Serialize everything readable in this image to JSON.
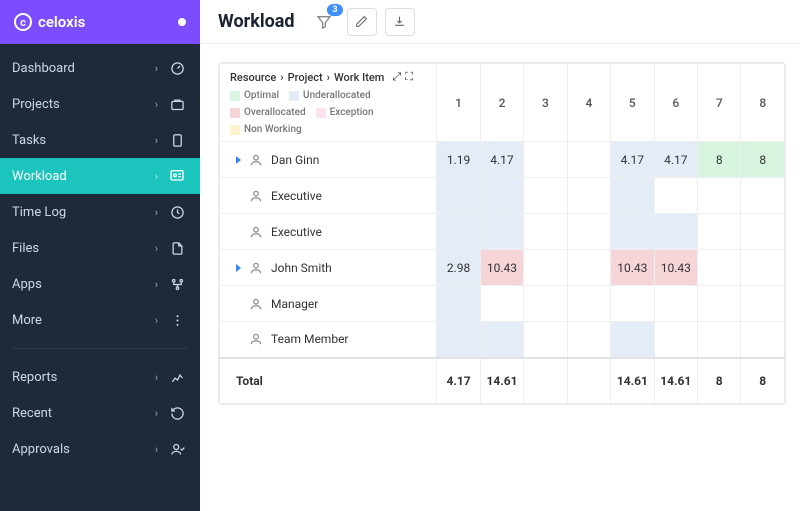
{
  "brand": "celoxis",
  "page_title": "Workload",
  "filter_badge": "3",
  "sidebar": {
    "items": [
      {
        "label": "Dashboard"
      },
      {
        "label": "Projects"
      },
      {
        "label": "Tasks"
      },
      {
        "label": "Workload"
      },
      {
        "label": "Time Log"
      },
      {
        "label": "Files"
      },
      {
        "label": "Apps"
      },
      {
        "label": "More"
      }
    ],
    "items2": [
      {
        "label": "Reports"
      },
      {
        "label": "Recent"
      },
      {
        "label": "Approvals"
      }
    ]
  },
  "breadcrumb": [
    "Resource",
    "Project",
    "Work Item"
  ],
  "legend": [
    {
      "label": "Optimal",
      "color": "#d7f5df"
    },
    {
      "label": "Underallocated",
      "color": "#e3ecf7"
    },
    {
      "label": "Overallocated",
      "color": "#f6d5d8"
    },
    {
      "label": "Exception",
      "color": "#fde2f0"
    },
    {
      "label": "Non Working",
      "color": "#fff3cd"
    }
  ],
  "columns": [
    "1",
    "2",
    "3",
    "4",
    "5",
    "6",
    "7",
    "8"
  ],
  "rows": [
    {
      "name": "Dan Ginn",
      "expandable": true,
      "cells": [
        {
          "v": "1.19",
          "c": "blue"
        },
        {
          "v": "4.17",
          "c": "blue"
        },
        {
          "v": "",
          "c": ""
        },
        {
          "v": "",
          "c": ""
        },
        {
          "v": "4.17",
          "c": "blue"
        },
        {
          "v": "4.17",
          "c": "blue"
        },
        {
          "v": "8",
          "c": "green"
        },
        {
          "v": "8",
          "c": "green"
        }
      ]
    },
    {
      "name": "Executive",
      "expandable": false,
      "cells": [
        {
          "v": "",
          "c": "blue"
        },
        {
          "v": "",
          "c": "blue"
        },
        {
          "v": "",
          "c": ""
        },
        {
          "v": "",
          "c": ""
        },
        {
          "v": "",
          "c": "blue"
        },
        {
          "v": "",
          "c": ""
        },
        {
          "v": "",
          "c": ""
        },
        {
          "v": "",
          "c": ""
        }
      ]
    },
    {
      "name": "Executive",
      "expandable": false,
      "cells": [
        {
          "v": "",
          "c": "blue"
        },
        {
          "v": "",
          "c": "blue"
        },
        {
          "v": "",
          "c": ""
        },
        {
          "v": "",
          "c": ""
        },
        {
          "v": "",
          "c": "blue"
        },
        {
          "v": "",
          "c": "blue"
        },
        {
          "v": "",
          "c": ""
        },
        {
          "v": "",
          "c": ""
        }
      ]
    },
    {
      "name": "John Smith",
      "expandable": true,
      "cells": [
        {
          "v": "2.98",
          "c": "blue"
        },
        {
          "v": "10.43",
          "c": "pink"
        },
        {
          "v": "",
          "c": ""
        },
        {
          "v": "",
          "c": ""
        },
        {
          "v": "10.43",
          "c": "pink"
        },
        {
          "v": "10.43",
          "c": "pink"
        },
        {
          "v": "",
          "c": ""
        },
        {
          "v": "",
          "c": ""
        }
      ]
    },
    {
      "name": "Manager",
      "expandable": false,
      "cells": [
        {
          "v": "",
          "c": "blue"
        },
        {
          "v": "",
          "c": ""
        },
        {
          "v": "",
          "c": ""
        },
        {
          "v": "",
          "c": ""
        },
        {
          "v": "",
          "c": ""
        },
        {
          "v": "",
          "c": ""
        },
        {
          "v": "",
          "c": ""
        },
        {
          "v": "",
          "c": ""
        }
      ]
    },
    {
      "name": "Team Member",
      "expandable": false,
      "cells": [
        {
          "v": "",
          "c": "blue"
        },
        {
          "v": "",
          "c": "blue"
        },
        {
          "v": "",
          "c": ""
        },
        {
          "v": "",
          "c": ""
        },
        {
          "v": "",
          "c": "blue"
        },
        {
          "v": "",
          "c": ""
        },
        {
          "v": "",
          "c": ""
        },
        {
          "v": "",
          "c": ""
        }
      ]
    }
  ],
  "total_label": "Total",
  "totals": [
    "4.17",
    "14.61",
    "",
    "",
    "14.61",
    "14.61",
    "8",
    "8"
  ]
}
